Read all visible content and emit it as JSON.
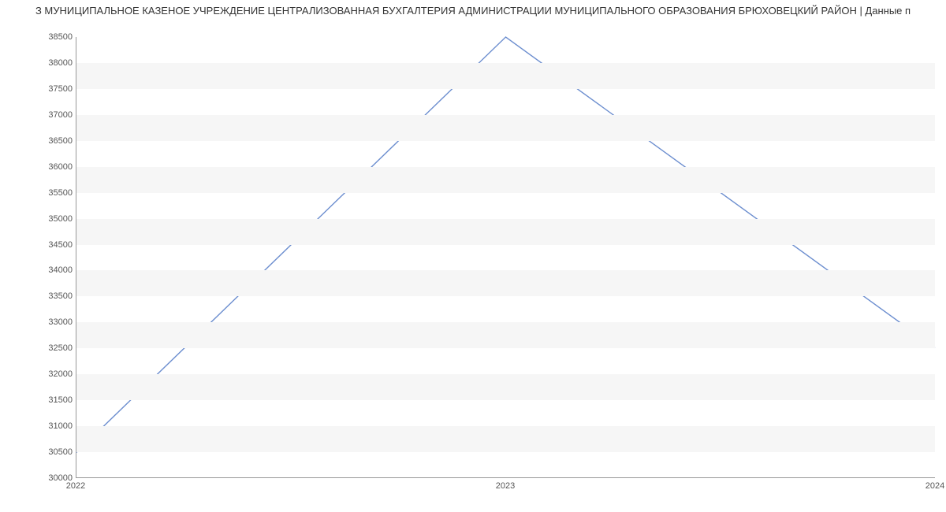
{
  "chart_data": {
    "type": "line",
    "title": "З МУНИЦИПАЛЬНОЕ КАЗЕНОЕ УЧРЕЖДЕНИЕ ЦЕНТРАЛИЗОВАННАЯ БУХГАЛТЕРИЯ АДМИНИСТРАЦИИ МУНИЦИПАЛЬНОГО ОБРАЗОВАНИЯ БРЮХОВЕЦКИЙ РАЙОН | Данные п",
    "categories": [
      "2022",
      "2023",
      "2024"
    ],
    "values": [
      30480,
      38500,
      32500
    ],
    "xlabel": "",
    "ylabel": "",
    "ylim": [
      30000,
      38500
    ],
    "yticks": [
      30000,
      30500,
      31000,
      31500,
      32000,
      32500,
      33000,
      33500,
      34000,
      34500,
      35000,
      35500,
      36000,
      36500,
      37000,
      37500,
      38000,
      38500
    ],
    "line_color": "#6c8ecf"
  }
}
